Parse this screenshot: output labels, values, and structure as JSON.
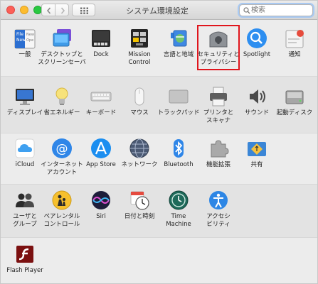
{
  "window": {
    "title": "システム環境設定",
    "search_placeholder": "検索"
  },
  "sections": [
    {
      "items": [
        {
          "id": "general",
          "label": "一般",
          "icon": "general-icon"
        },
        {
          "id": "desktop",
          "label": "デスクトップと\nスクリーンセーバ",
          "icon": "desktop-screensaver-icon"
        },
        {
          "id": "dock",
          "label": "Dock",
          "icon": "dock-icon"
        },
        {
          "id": "mission",
          "label": "Mission\nControl",
          "icon": "mission-control-icon"
        },
        {
          "id": "language",
          "label": "言語と地域",
          "icon": "language-region-icon"
        },
        {
          "id": "security",
          "label": "セキュリティと\nプライバシー",
          "icon": "security-privacy-icon",
          "highlighted": true
        },
        {
          "id": "spotlight",
          "label": "Spotlight",
          "icon": "spotlight-icon"
        },
        {
          "id": "notifications",
          "label": "通知",
          "icon": "notifications-icon"
        }
      ]
    },
    {
      "items": [
        {
          "id": "displays",
          "label": "ディスプレイ",
          "icon": "display-icon"
        },
        {
          "id": "energy",
          "label": "省エネルギー",
          "icon": "energy-saver-icon"
        },
        {
          "id": "keyboard",
          "label": "キーボード",
          "icon": "keyboard-icon"
        },
        {
          "id": "mouse",
          "label": "マウス",
          "icon": "mouse-icon"
        },
        {
          "id": "trackpad",
          "label": "トラックパッド",
          "icon": "trackpad-icon"
        },
        {
          "id": "printers",
          "label": "プリンタと\nスキャナ",
          "icon": "printer-icon"
        },
        {
          "id": "sound",
          "label": "サウンド",
          "icon": "sound-icon"
        },
        {
          "id": "startup",
          "label": "起動ディスク",
          "icon": "startup-disk-icon"
        }
      ]
    },
    {
      "items": [
        {
          "id": "icloud",
          "label": "iCloud",
          "icon": "icloud-icon"
        },
        {
          "id": "internet",
          "label": "インターネット\nアカウント",
          "icon": "internet-accounts-icon"
        },
        {
          "id": "appstore",
          "label": "App Store",
          "icon": "app-store-icon"
        },
        {
          "id": "network",
          "label": "ネットワーク",
          "icon": "network-icon"
        },
        {
          "id": "bluetooth",
          "label": "Bluetooth",
          "icon": "bluetooth-icon"
        },
        {
          "id": "extensions",
          "label": "機能拡張",
          "icon": "extensions-icon"
        },
        {
          "id": "sharing",
          "label": "共有",
          "icon": "sharing-icon"
        }
      ]
    },
    {
      "items": [
        {
          "id": "users",
          "label": "ユーザと\nグループ",
          "icon": "users-groups-icon"
        },
        {
          "id": "parental",
          "label": "ペアレンタル\nコントロール",
          "icon": "parental-controls-icon"
        },
        {
          "id": "siri",
          "label": "Siri",
          "icon": "siri-icon"
        },
        {
          "id": "datetime",
          "label": "日付と時刻",
          "icon": "date-time-icon"
        },
        {
          "id": "timemachine",
          "label": "Time\nMachine",
          "icon": "time-machine-icon"
        },
        {
          "id": "accessibility",
          "label": "アクセシ\nビリティ",
          "icon": "accessibility-icon"
        }
      ]
    },
    {
      "items": [
        {
          "id": "flash",
          "label": "Flash Player",
          "icon": "flash-player-icon"
        }
      ]
    }
  ],
  "colors": {
    "highlight": "#e0151c",
    "accent_blue": "#1a82f5"
  }
}
